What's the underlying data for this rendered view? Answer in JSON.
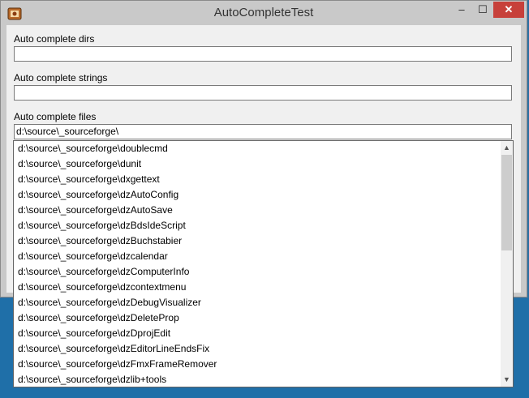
{
  "window": {
    "title": "AutoCompleteTest",
    "controls": {
      "minimize": "–",
      "maximize": "☐",
      "close": "✕"
    }
  },
  "fields": {
    "dirs": {
      "label": "Auto complete dirs",
      "value": ""
    },
    "strings": {
      "label": "Auto complete strings",
      "value": ""
    },
    "files": {
      "label": "Auto complete files",
      "value": "d:\\source\\_sourceforge\\"
    }
  },
  "suggestions": [
    "d:\\source\\_sourceforge\\doublecmd",
    "d:\\source\\_sourceforge\\dunit",
    "d:\\source\\_sourceforge\\dxgettext",
    "d:\\source\\_sourceforge\\dzAutoConfig",
    "d:\\source\\_sourceforge\\dzAutoSave",
    "d:\\source\\_sourceforge\\dzBdsIdeScript",
    "d:\\source\\_sourceforge\\dzBuchstabier",
    "d:\\source\\_sourceforge\\dzcalendar",
    "d:\\source\\_sourceforge\\dzComputerInfo",
    "d:\\source\\_sourceforge\\dzcontextmenu",
    "d:\\source\\_sourceforge\\dzDebugVisualizer",
    "d:\\source\\_sourceforge\\dzDeleteProp",
    "d:\\source\\_sourceforge\\dzDprojEdit",
    "d:\\source\\_sourceforge\\dzEditorLineEndsFix",
    "d:\\source\\_sourceforge\\dzFmxFrameRemover",
    "d:\\source\\_sourceforge\\dzlib+tools"
  ],
  "scrollbar": {
    "up": "▲",
    "down": "▼"
  }
}
